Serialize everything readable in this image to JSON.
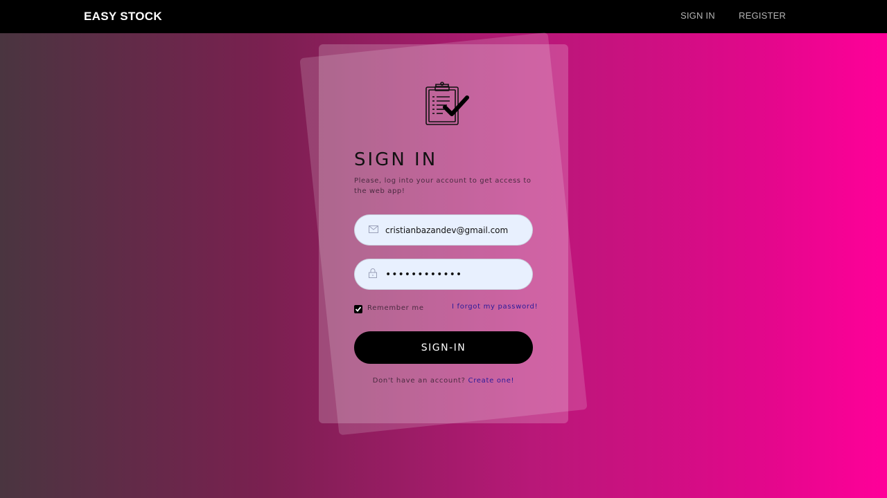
{
  "navbar": {
    "brand": "EASY STOCK",
    "links": [
      {
        "label": "SIGN IN"
      },
      {
        "label": "REGISTER"
      }
    ]
  },
  "form": {
    "title": "SIGN IN",
    "subtitle": "Please, log into your account to get access to the web app!",
    "email_value": "cristianbazandev@gmail.com",
    "password_value": "••••••••••••",
    "remember_label": "Remember me",
    "remember_checked": true,
    "forgot_label": "I forgot my password!",
    "submit_label": "SIGN-IN",
    "no_account_text": "Don't have an account?",
    "create_label": "Create one!"
  },
  "icons": {
    "logo": "clipboard-check-icon",
    "email": "mail-icon",
    "password": "lock-icon"
  },
  "colors": {
    "navbar_bg": "#000000",
    "button_bg": "#000000",
    "link": "#2a1a9a",
    "gradient_start": "#4a3540",
    "gradient_end": "#ff0099",
    "field_bg": "#e8f0fe"
  }
}
